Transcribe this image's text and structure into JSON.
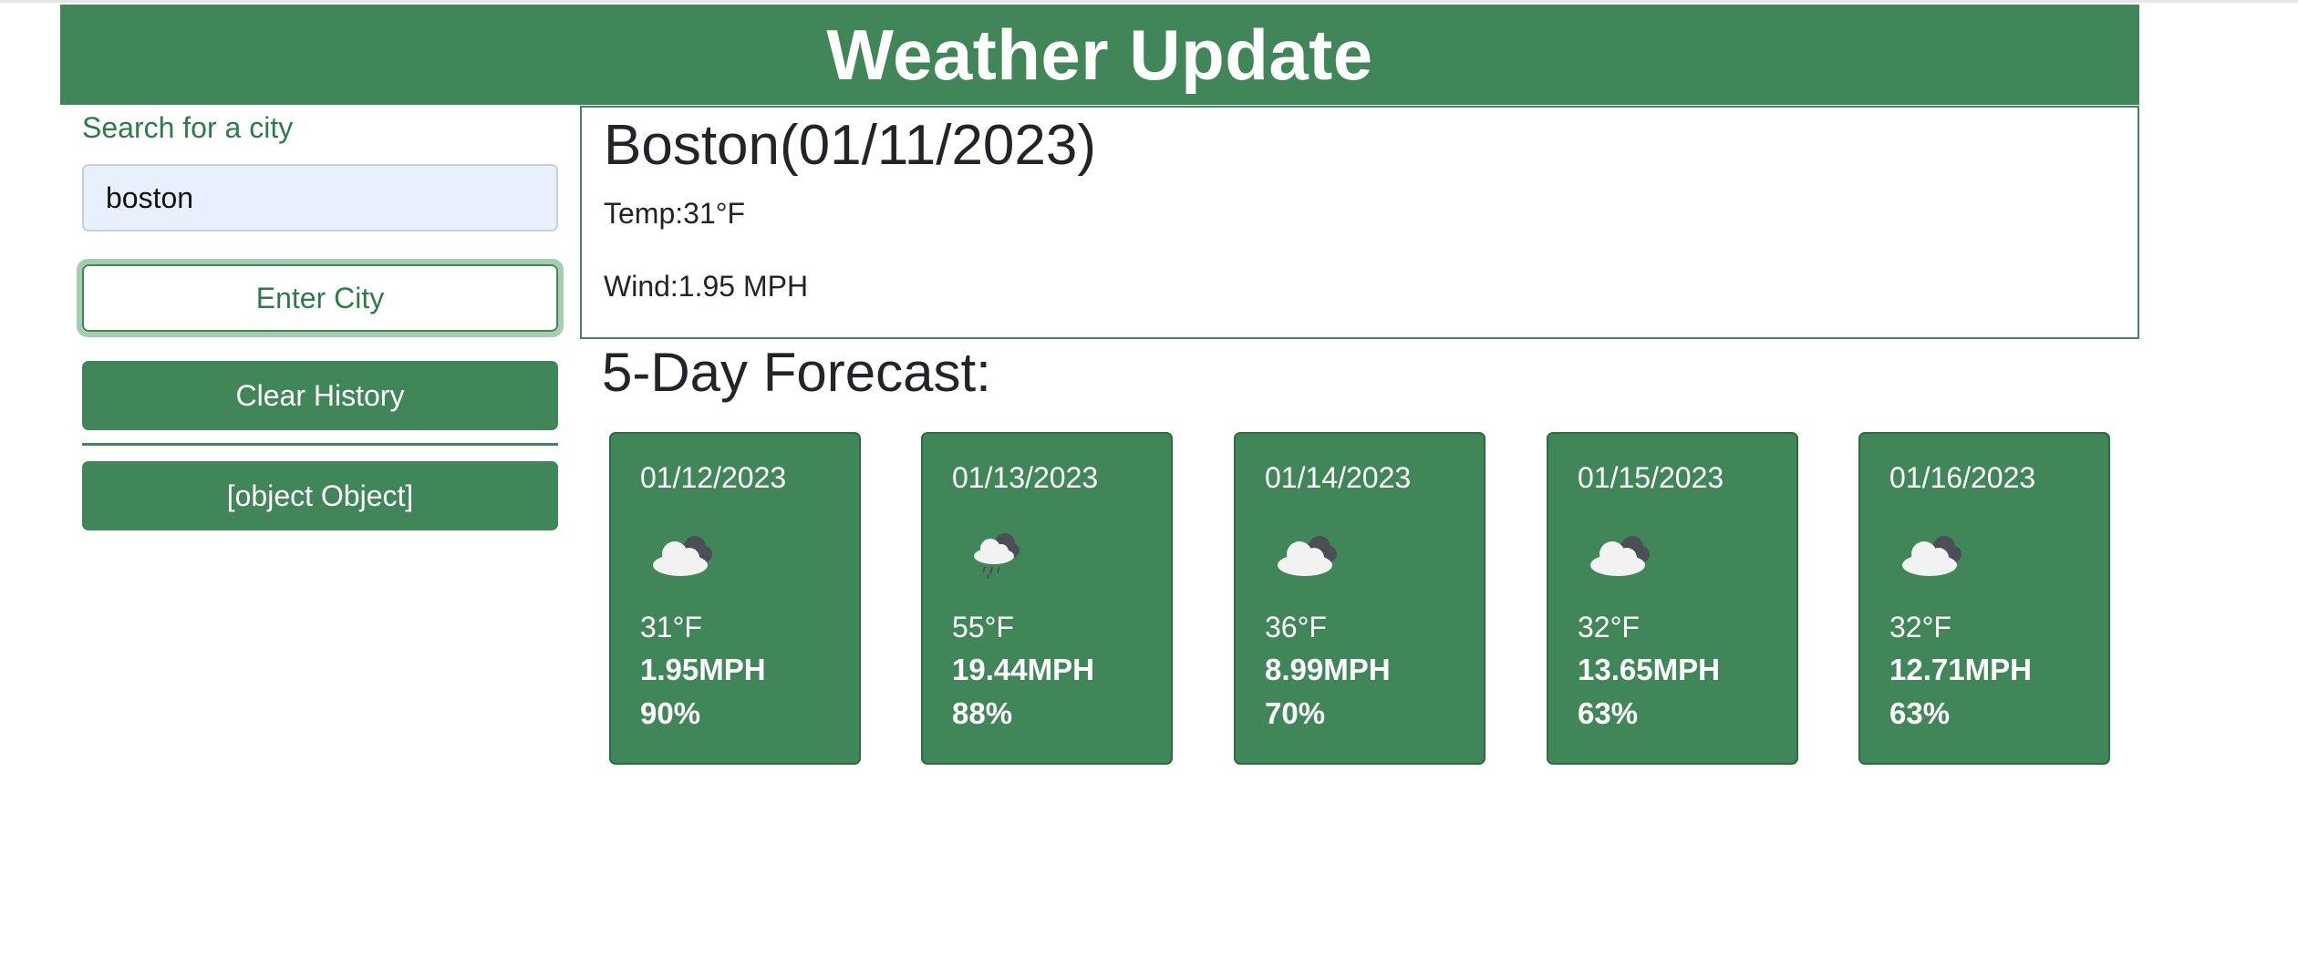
{
  "header": {
    "title": "Weather Update"
  },
  "sidebar": {
    "search_label": "Search for a city",
    "search_value": "boston",
    "enter_button": "Enter City",
    "clear_button": "Clear History",
    "history": [
      "[object Object]"
    ]
  },
  "current": {
    "city_title": "Boston(01/11/2023)",
    "temp": "Temp:31°F",
    "wind": "Wind:1.95 MPH"
  },
  "forecast": {
    "title": "5-Day Forecast:",
    "days": [
      {
        "date": "01/12/2023",
        "icon": "cloud-icon",
        "temp": "31°F",
        "wind": "1.95MPH",
        "humidity": "90%"
      },
      {
        "date": "01/13/2023",
        "icon": "rain-cloud-icon",
        "temp": "55°F",
        "wind": "19.44MPH",
        "humidity": "88%"
      },
      {
        "date": "01/14/2023",
        "icon": "cloud-icon",
        "temp": "36°F",
        "wind": "8.99MPH",
        "humidity": "70%"
      },
      {
        "date": "01/15/2023",
        "icon": "cloud-icon",
        "temp": "32°F",
        "wind": "13.65MPH",
        "humidity": "63%"
      },
      {
        "date": "01/16/2023",
        "icon": "cloud-icon",
        "temp": "32°F",
        "wind": "12.71MPH",
        "humidity": "63%"
      }
    ]
  },
  "colors": {
    "brand_green": "#418658",
    "input_bg": "#e8f0fe"
  }
}
